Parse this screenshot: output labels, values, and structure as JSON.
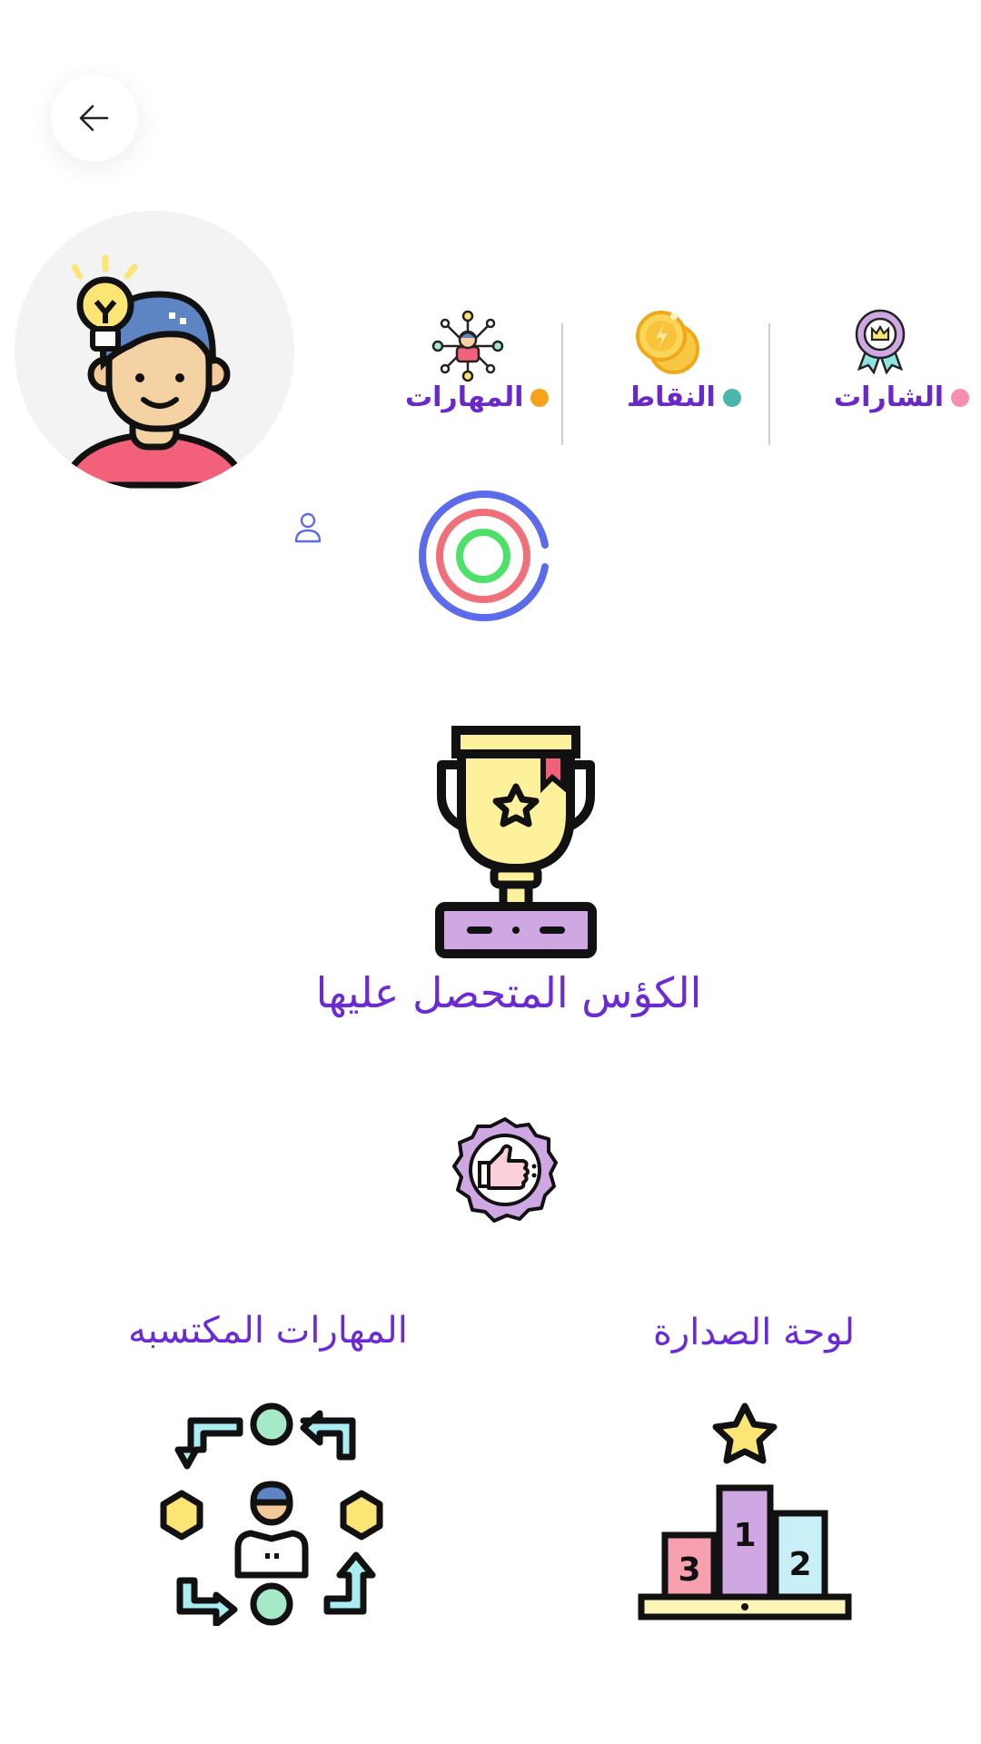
{
  "stats": {
    "badges": {
      "label": "الشارات",
      "dot_color": "#f48fb1",
      "icon": "badge-icon"
    },
    "points": {
      "label": "النقاط",
      "dot_color": "#4db6ac",
      "icon": "coins-icon"
    },
    "skills": {
      "label": "المهارات",
      "dot_color": "#f5a31b",
      "icon": "network-icon"
    }
  },
  "rings": {
    "outer_color": "#5b6bea",
    "middle_color": "#f0707a",
    "inner_color": "#4fe06a"
  },
  "trophies": {
    "title": "الكؤس المتحصل عليها",
    "icon": "trophy-icon"
  },
  "like_badge": {
    "icon": "thumbs-up-badge-icon"
  },
  "leaderboard": {
    "title": "لوحة الصدارة",
    "icon": "podium-icon"
  },
  "acquired_skills": {
    "title": "المهارات المكتسبه",
    "icon": "skills-cycle-icon"
  },
  "colors": {
    "accent": "#6a2ad4"
  }
}
